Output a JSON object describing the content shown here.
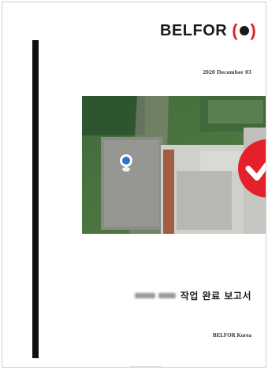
{
  "brand": {
    "logo_text": "BELFOR",
    "logo_colors": {
      "text": "#1a1a1a",
      "mark": "#e4202a",
      "dot": "#1a1a1a"
    }
  },
  "cover": {
    "date": "2020 December 03",
    "title": "작업 완료 보고서",
    "footer": "BELFOR Korea"
  },
  "photo": {
    "description_icon": "map-pin-icon",
    "badge_icon": "checkmark-badge-icon",
    "badge_color": "#e4202a"
  }
}
